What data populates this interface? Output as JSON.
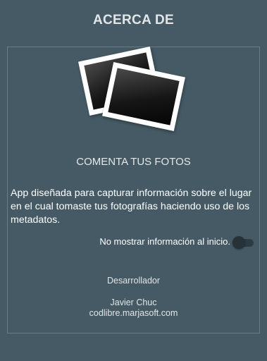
{
  "header": {
    "title": "ACERCA DE"
  },
  "app": {
    "icon": "photos-icon",
    "name": "COMENTA TUS FOTOS",
    "description": "App diseñada para capturar información sobre el lugar en el cual tomaste tus fotografías haciendo uso de los metadatos."
  },
  "settings": {
    "startup_toggle_label": "No mostrar información al inicio.",
    "startup_toggle_on": false
  },
  "developer": {
    "heading": "Desarrollador",
    "name": "Javier Chuc",
    "website": "codlibre.marjasoft.com"
  },
  "colors": {
    "background": "#455a64",
    "border": "#6a7d86",
    "switch_thumb": "#263238"
  }
}
